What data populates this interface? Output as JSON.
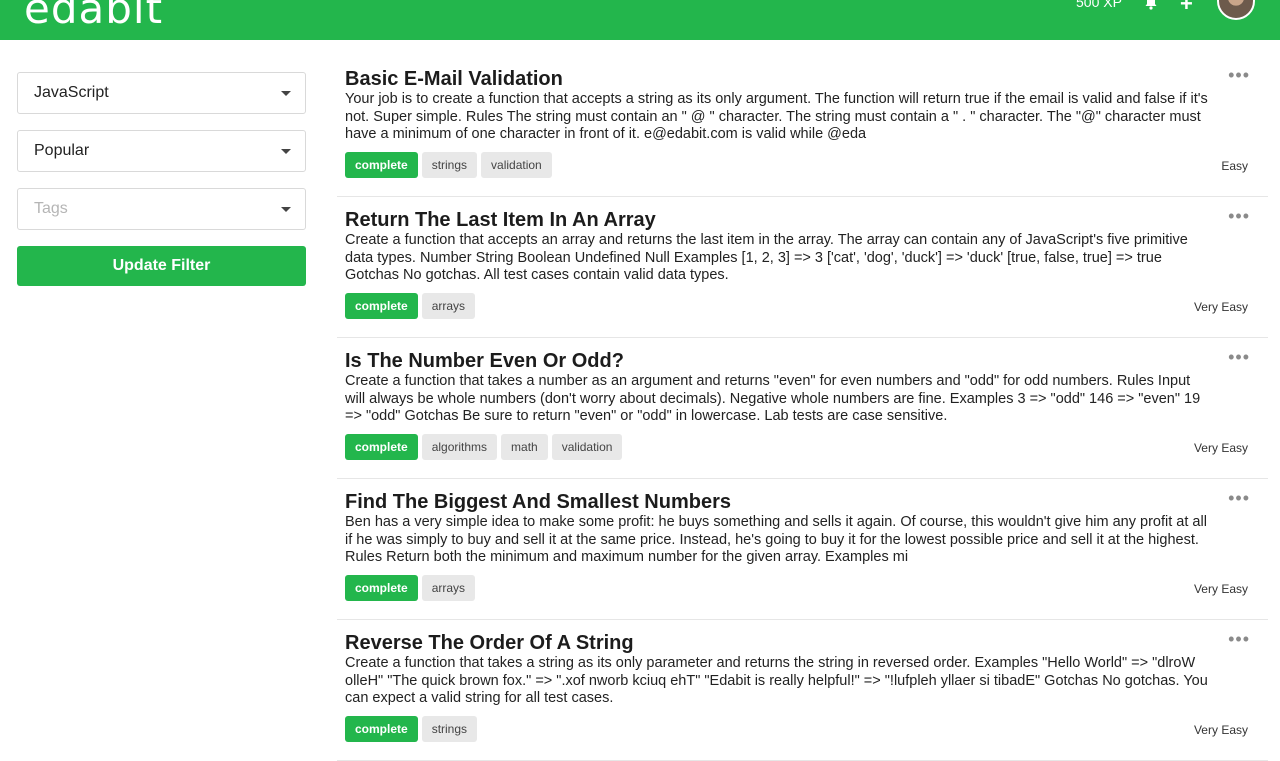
{
  "header": {
    "logo": "edabit",
    "xp": "500 XP",
    "icons": [
      "bell-icon",
      "plus-icon",
      "avatar"
    ]
  },
  "filters": {
    "language": "JavaScript",
    "sort": "Popular",
    "tags_placeholder": "Tags",
    "update_label": "Update Filter"
  },
  "challenges": [
    {
      "title": "Basic E-Mail Validation",
      "description": "Your job is to create a function that accepts a string as its only argument. The function will return true if the email is valid and false if it's not. Super simple. Rules The string must contain an \" @ \" character. The string must contain a \" . \" character. The \"@\" character must have a minimum of one character in front of it. e@edabit.com is valid while @eda",
      "status": "complete",
      "tags": [
        "strings",
        "validation"
      ],
      "difficulty": "Easy"
    },
    {
      "title": "Return The Last Item In An Array",
      "description": "Create a function that accepts an array and returns the last item in the array. The array can contain any of JavaScript's five primitive data types. Number String Boolean Undefined Null Examples [1, 2, 3] => 3 ['cat', 'dog', 'duck'] => 'duck' [true, false, true] => true Gotchas No gotchas. All test cases contain valid data types.",
      "status": "complete",
      "tags": [
        "arrays"
      ],
      "difficulty": "Very Easy"
    },
    {
      "title": "Is The Number Even Or Odd?",
      "description": "Create a function that takes a number as an argument and returns \"even\" for even numbers and \"odd\" for odd numbers. Rules Input will always be whole numbers (don't worry about decimals). Negative whole numbers are fine. Examples 3 => \"odd\" 146 => \"even\" 19 => \"odd\" Gotchas Be sure to return \"even\" or \"odd\" in lowercase. Lab tests are case sensitive.",
      "status": "complete",
      "tags": [
        "algorithms",
        "math",
        "validation"
      ],
      "difficulty": "Very Easy"
    },
    {
      "title": "Find The Biggest And Smallest Numbers",
      "description": "Ben has a very simple idea to make some profit: he buys something and sells it again. Of course, this wouldn't give him any profit at all if he was simply to buy and sell it at the same price. Instead, he's going to buy it for the lowest possible price and sell it at the highest. Rules Return both the minimum and maximum number for the given array. Examples mi",
      "status": "complete",
      "tags": [
        "arrays"
      ],
      "difficulty": "Very Easy"
    },
    {
      "title": "Reverse The Order Of A String",
      "description": "Create a function that takes a string as its only parameter and returns the string in reversed order. Examples \"Hello World\" => \"dlroW olleH\" \"The quick brown fox.\" => \".xof nworb kciuq ehT\" \"Edabit is really helpful!\" => \"!lufpleh yllaer si tibadE\" Gotchas No gotchas. You can expect a valid string for all test cases.",
      "status": "complete",
      "tags": [
        "strings"
      ],
      "difficulty": "Very Easy"
    }
  ]
}
